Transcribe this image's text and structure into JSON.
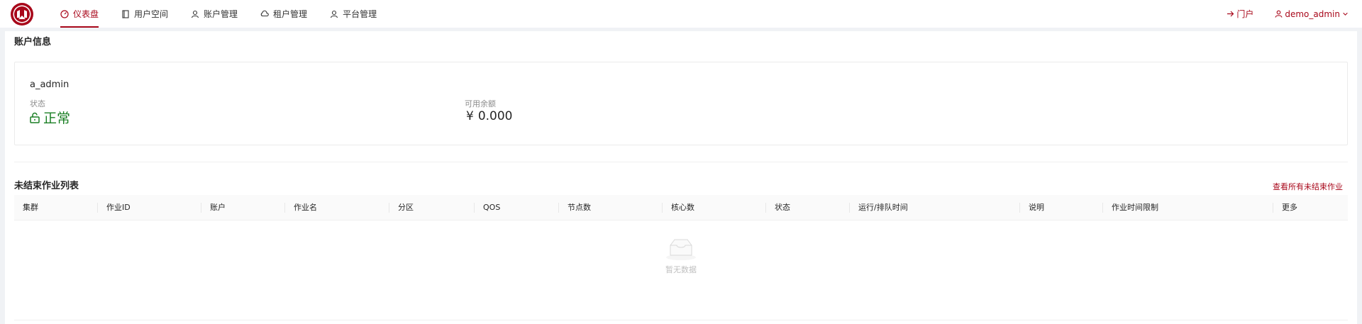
{
  "nav": {
    "items": [
      {
        "label": "仪表盘",
        "icon": "dashboard-icon",
        "active": true
      },
      {
        "label": "用户空间",
        "icon": "book-icon",
        "active": false
      },
      {
        "label": "账户管理",
        "icon": "user-icon",
        "active": false
      },
      {
        "label": "租户管理",
        "icon": "cloud-icon",
        "active": false
      },
      {
        "label": "平台管理",
        "icon": "user-icon",
        "active": false
      }
    ]
  },
  "header": {
    "portal_label": "门户",
    "username": "demo_admin"
  },
  "account_info": {
    "title": "账户信息",
    "account_name": "a_admin",
    "status_label": "状态",
    "status_value": "正常",
    "balance_label": "可用余额",
    "currency_symbol": "¥",
    "balance_value": "0.000"
  },
  "jobs": {
    "title": "未结束作业列表",
    "view_all": "查看所有未结束作业",
    "columns": [
      "集群",
      "作业ID",
      "账户",
      "作业名",
      "分区",
      "QOS",
      "节点数",
      "核心数",
      "状态",
      "运行/排队时间",
      "说明",
      "作业时间限制",
      "更多"
    ],
    "empty_text": "暂无数据"
  },
  "colors": {
    "accent": "#a8071a",
    "status_ok": "#1a7f24"
  }
}
